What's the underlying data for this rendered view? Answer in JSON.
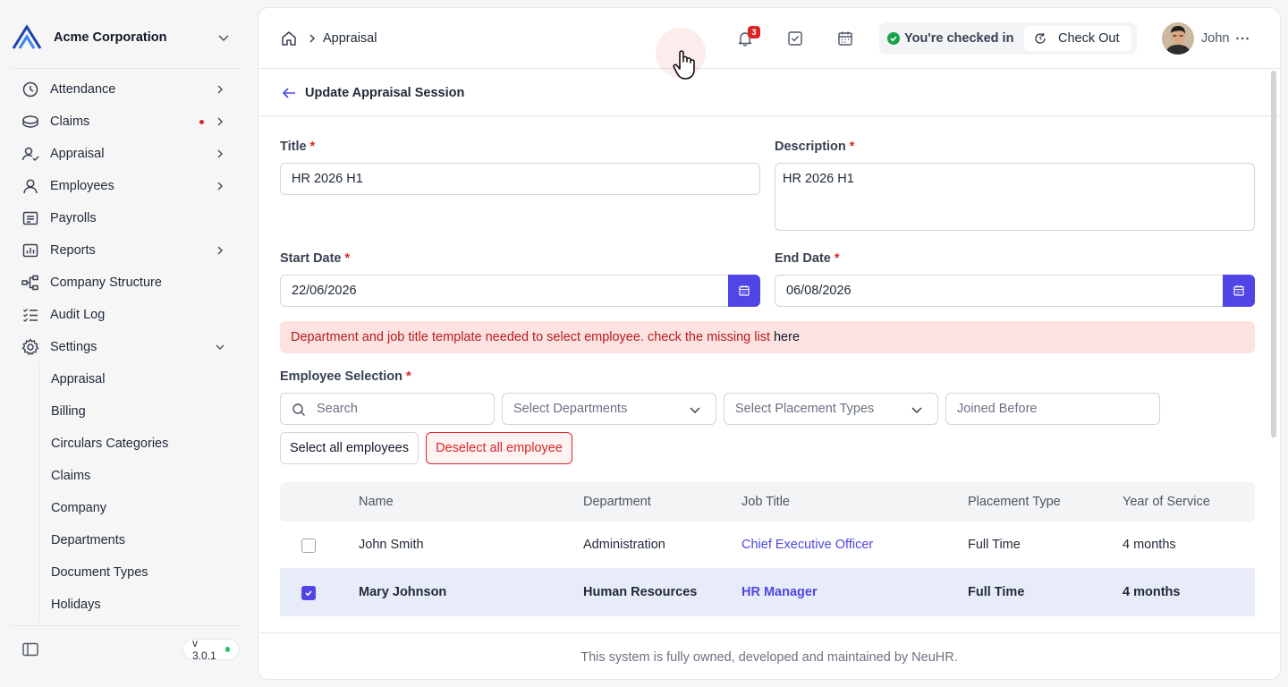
{
  "org": {
    "name": "Acme Corporation"
  },
  "sidebar": {
    "items": [
      {
        "label": "Attendance",
        "icon": "clock-icon"
      },
      {
        "label": "Claims",
        "icon": "coins-icon"
      },
      {
        "label": "Appraisal",
        "icon": "user-check-icon"
      },
      {
        "label": "Employees",
        "icon": "user-icon"
      },
      {
        "label": "Payrolls",
        "icon": "receipt-icon"
      },
      {
        "label": "Reports",
        "icon": "chart-icon"
      },
      {
        "label": "Company Structure",
        "icon": "hierarchy-icon"
      },
      {
        "label": "Audit Log",
        "icon": "list-check-icon"
      },
      {
        "label": "Settings",
        "icon": "gear-icon"
      }
    ],
    "settings_sub": [
      "Appraisal",
      "Billing",
      "Circulars Categories",
      "Claims",
      "Company",
      "Departments",
      "Document Types",
      "Holidays"
    ],
    "version": "v 3.0.1"
  },
  "topbar": {
    "breadcrumb": "Appraisal",
    "notification_count": "3",
    "checkin_status": "You're checked in",
    "checkout_label": "Check Out",
    "user_name": "John"
  },
  "page": {
    "title": "Update Appraisal Session"
  },
  "form": {
    "title_label": "Title",
    "title_value": "HR 2026 H1",
    "description_label": "Description",
    "description_value": "HR 2026 H1",
    "start_label": "Start Date",
    "start_value": "22/06/2026",
    "end_label": "End Date",
    "end_value": "06/08/2026",
    "required_mark": "*",
    "alert_text": "Department and job title template needed to select employee. check the missing list",
    "alert_link": "here",
    "employee_label": "Employee Selection",
    "search_placeholder": "Search",
    "departments_placeholder": "Select Departments",
    "placement_placeholder": "Select Placement Types",
    "joined_placeholder": "Joined Before",
    "select_all": "Select all employees",
    "deselect_all": "Deselect all employee"
  },
  "table": {
    "headers": [
      "Name",
      "Department",
      "Job Title",
      "Placement Type",
      "Year of Service"
    ],
    "rows": [
      {
        "checked": false,
        "name": "John Smith",
        "department": "Administration",
        "job_title": "Chief Executive Officer",
        "placement": "Full Time",
        "service": "4 months"
      },
      {
        "checked": true,
        "name": "Mary Johnson",
        "department": "Human Resources",
        "job_title": "HR Manager",
        "placement": "Full Time",
        "service": "4 months"
      }
    ]
  },
  "footer": {
    "text": "This system is fully owned, developed and maintained by NeuHR."
  },
  "colors": {
    "accent": "#4f46e5",
    "danger": "#dc2626",
    "success": "#16a34a"
  }
}
